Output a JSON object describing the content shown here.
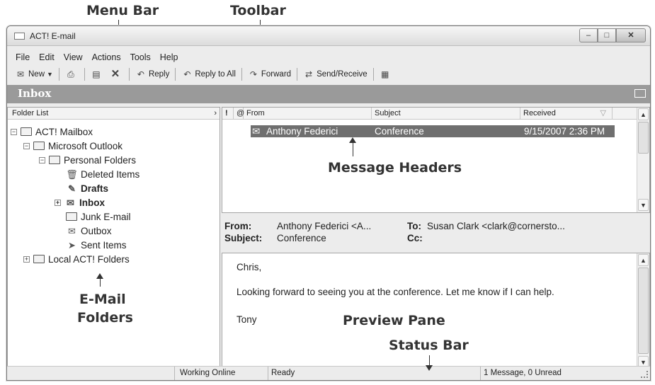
{
  "callouts": {
    "menu_bar": "Menu Bar",
    "toolbar": "Toolbar",
    "message_headers": "Message Headers",
    "email_folders_line1": "E-Mail",
    "email_folders_line2": "Folders",
    "preview_pane": "Preview Pane",
    "status_bar": "Status Bar"
  },
  "window": {
    "title": "ACT! E-mail"
  },
  "menu": [
    "File",
    "Edit",
    "View",
    "Actions",
    "Tools",
    "Help"
  ],
  "toolbar": {
    "new": "New",
    "reply": "Reply",
    "reply_all": "Reply to All",
    "forward": "Forward",
    "send_receive": "Send/Receive"
  },
  "inbox_bar": {
    "title": "Inbox"
  },
  "folders": {
    "header": "Folder List",
    "items": [
      "ACT! Mailbox",
      "Microsoft Outlook",
      "Personal Folders",
      "Deleted Items",
      "Drafts",
      "Inbox",
      "Junk E-mail",
      "Outbox",
      "Sent Items",
      "Local ACT! Folders"
    ]
  },
  "messages": {
    "columns": {
      "from": "From",
      "subject": "Subject",
      "received": "Received"
    },
    "rows": [
      {
        "from": "Anthony Federici",
        "subject": "Conference",
        "received": "9/15/2007  2:36 PM"
      }
    ]
  },
  "preview": {
    "from_label": "From:",
    "from_value": "Anthony Federici <A...",
    "to_label": "To:",
    "to_value": "Susan Clark <clark@cornersto...",
    "subject_label": "Subject:",
    "subject_value": "Conference",
    "cc_label": "Cc:",
    "body": [
      "Chris,",
      "Looking forward to seeing you at the conference. Let me know if I can help.",
      "Tony"
    ]
  },
  "status": {
    "working_online": "Working Online",
    "ready": "Ready",
    "summary": "1 Message, 0 Unread"
  }
}
